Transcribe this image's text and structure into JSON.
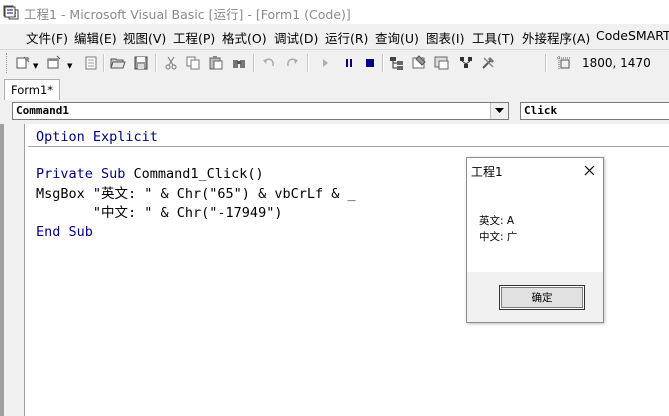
{
  "window": {
    "title": "工程1 - Microsoft Visual Basic [运行] - [Form1 (Code)]"
  },
  "menu": {
    "items": [
      {
        "label": "文件(F)"
      },
      {
        "label": "编辑(E)"
      },
      {
        "label": "视图(V)"
      },
      {
        "label": "工程(P)"
      },
      {
        "label": "格式(O)"
      },
      {
        "label": "调试(D)"
      },
      {
        "label": "运行(R)"
      },
      {
        "label": "查询(U)"
      },
      {
        "label": "图表(I)"
      },
      {
        "label": "工具(T)"
      },
      {
        "label": "外接程序(A)"
      },
      {
        "label": "CodeSMART"
      }
    ]
  },
  "toolbar": {
    "icons": [
      "add-project-icon",
      "add-form-icon",
      "menu-editor-icon",
      "open-project-icon",
      "save-project-icon",
      "cut-icon",
      "copy-icon",
      "paste-icon",
      "find-icon",
      "undo-icon",
      "redo-icon",
      "run-icon",
      "break-icon",
      "end-icon",
      "project-explorer-icon",
      "properties-window-icon",
      "form-layout-icon",
      "object-browser-icon",
      "toolbox-icon",
      "position-icon"
    ],
    "coords": "1800, 1470"
  },
  "tab": {
    "label": "Form1*"
  },
  "combos": {
    "object": "Command1",
    "procedure": "Click"
  },
  "code": {
    "line1": "Option Explicit",
    "line2": "Private Sub Command1_Click()",
    "line3": "MsgBox \"英文: \" & Chr(\"65\") & vbCrLf & _",
    "line4": "       \"中文: \" & Chr(\"-17949\")",
    "line5": "End Sub"
  },
  "dialog": {
    "title": "工程1",
    "line1": "英文: A",
    "line2": "中文: 广",
    "ok_label": "确定"
  },
  "colors": {
    "keyword": "#000080",
    "title_text": "#8a8a8a",
    "run_blue": "#000080"
  }
}
